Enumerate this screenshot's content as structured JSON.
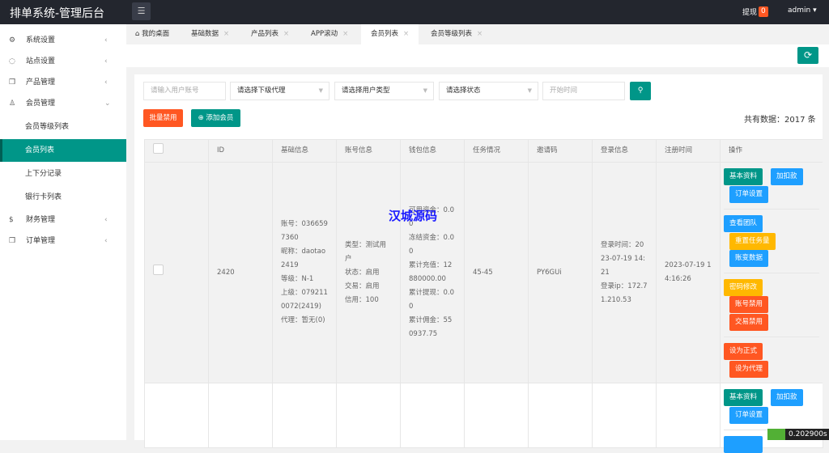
{
  "header": {
    "title": "排单系统-管理后台",
    "withdraw_label": "提现",
    "withdraw_count": "0",
    "user": "admin"
  },
  "sidebar": {
    "items": [
      {
        "label": "系统设置",
        "icon": "gear-icon"
      },
      {
        "label": "站点设置",
        "icon": "site-icon"
      },
      {
        "label": "产品管理",
        "icon": "box-icon"
      },
      {
        "label": "会员管理",
        "icon": "user-icon"
      },
      {
        "label": "会员等级列表"
      },
      {
        "label": "会员列表"
      },
      {
        "label": "上下分记录"
      },
      {
        "label": "银行卡列表"
      },
      {
        "label": "财务管理",
        "icon": "dollar-icon"
      },
      {
        "label": "订单管理",
        "icon": "box-icon"
      }
    ]
  },
  "tabs": [
    {
      "label": "我的桌面"
    },
    {
      "label": "基础数据"
    },
    {
      "label": "产品列表"
    },
    {
      "label": "APP滚动"
    },
    {
      "label": "会员列表"
    },
    {
      "label": "会员等级列表"
    }
  ],
  "filters": {
    "account_placeholder": "请输入用户账号",
    "agent": "请选择下级代理",
    "user_type": "请选择用户类型",
    "status": "请选择状态",
    "time_placeholder": "开始时间"
  },
  "toolbar": {
    "batch_disable": "批量禁用",
    "add_member": "添加会员",
    "total": "共有数据：2017 条"
  },
  "table": {
    "headers": [
      "ID",
      "基础信息",
      "账号信息",
      "钱包信息",
      "任务情况",
      "邀请码",
      "登录信息",
      "注册时间",
      "操作"
    ],
    "rows": [
      {
        "id": "2420",
        "basic": [
          "账号：0366597360",
          "昵称：daotao2419",
          "等级：N-1",
          "上级：0792110072(2419)",
          "代理：暂无(0)"
        ],
        "account": [
          "类型：测试用户",
          "状态：启用",
          "交易：启用",
          "信用：100"
        ],
        "wallet": [
          "可用资金：0.00",
          "冻结资金：0.00",
          "累计充值：12880000.00",
          "累计提现：0.00",
          "累计佣金：550937.75"
        ],
        "task": "45-45",
        "invite": "PY6GUi",
        "login": [
          "登录时间：2023-07-19 14:21",
          "登录ip：172.71.210.53"
        ],
        "reg": "2023-07-19 14:16:26"
      }
    ]
  },
  "actions": {
    "basic": "基本资料",
    "adjust": "加扣款",
    "order": "订单设置",
    "team": "查看团队",
    "reset": "重置任务量",
    "ledger": "账变数据",
    "pwd": "密码修改",
    "acct_ban": "账号禁用",
    "trade_ban": "交易禁用",
    "formal": "设为正式",
    "agent": "设为代理"
  },
  "watermark": "汉城源码",
  "timer": "0.202900s",
  "colors": {
    "primary": "#009688",
    "blue": "#1e9fff",
    "warn": "#ffb800",
    "danger": "#ff5722"
  }
}
